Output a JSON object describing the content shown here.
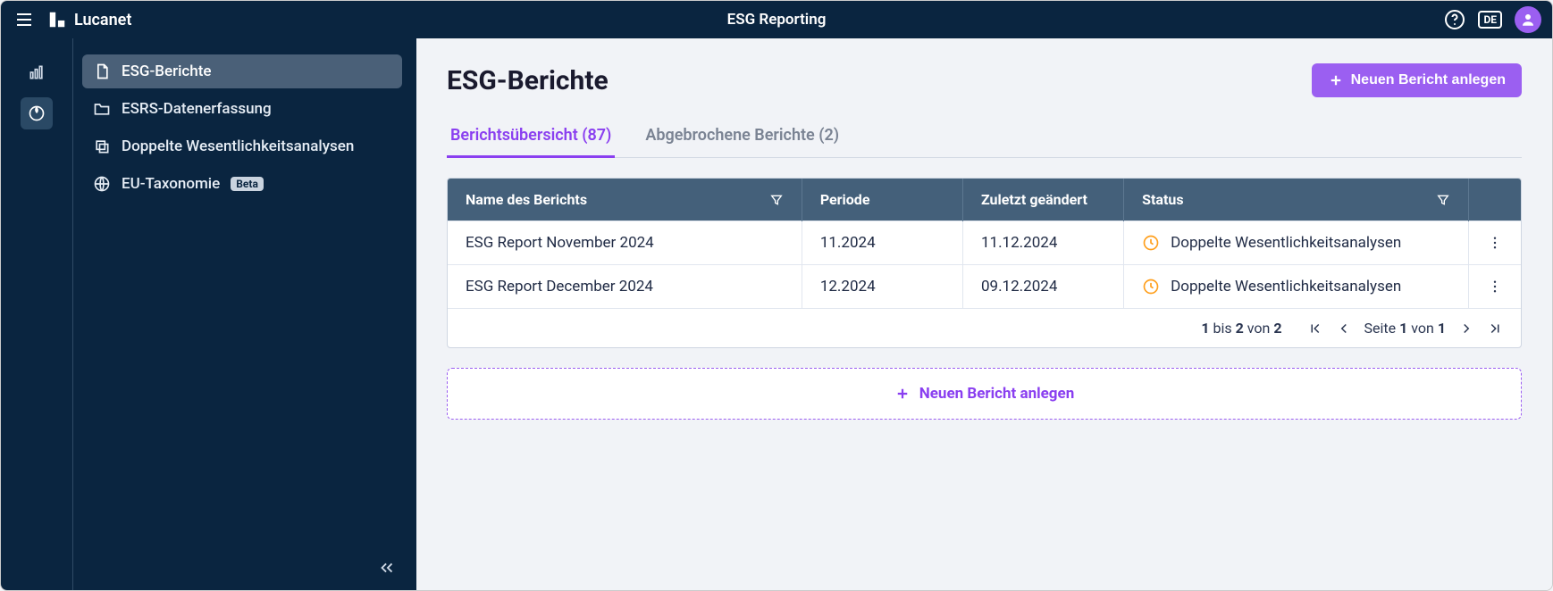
{
  "header": {
    "brand": "Lucanet",
    "title": "ESG Reporting",
    "lang": "DE"
  },
  "sidebar": {
    "items": [
      {
        "label": "ESG-Berichte"
      },
      {
        "label": "ESRS-Datenerfassung"
      },
      {
        "label": "Doppelte Wesentlichkeitsanalysen"
      },
      {
        "label": "EU-Taxonomie",
        "badge": "Beta"
      }
    ]
  },
  "main": {
    "page_title": "ESG-Berichte",
    "new_report_btn": "Neuen Bericht anlegen",
    "tabs": [
      {
        "label": "Berichtsübersicht (87)",
        "active": true
      },
      {
        "label": "Abgebrochene Berichte (2)",
        "active": false
      }
    ],
    "columns": {
      "name": "Name des Berichts",
      "period": "Periode",
      "changed": "Zuletzt geändert",
      "status": "Status"
    },
    "rows": [
      {
        "name": "ESG Report November 2024",
        "period": "11.2024",
        "changed": "11.12.2024",
        "status": "Doppelte Wesentlichkeitsanalysen"
      },
      {
        "name": "ESG Report December 2024",
        "period": "12.2024",
        "changed": "09.12.2024",
        "status": "Doppelte Wesentlichkeitsanalysen"
      }
    ],
    "pagination": {
      "range_from": "1",
      "range_to": "2",
      "range_total": "2",
      "range_word_bis": "bis",
      "range_word_von": "von",
      "page_label_prefix": "Seite",
      "page_current": "1",
      "page_total": "1",
      "page_word_von": "von"
    },
    "dashed_add_label": "Neuen Bericht anlegen"
  }
}
